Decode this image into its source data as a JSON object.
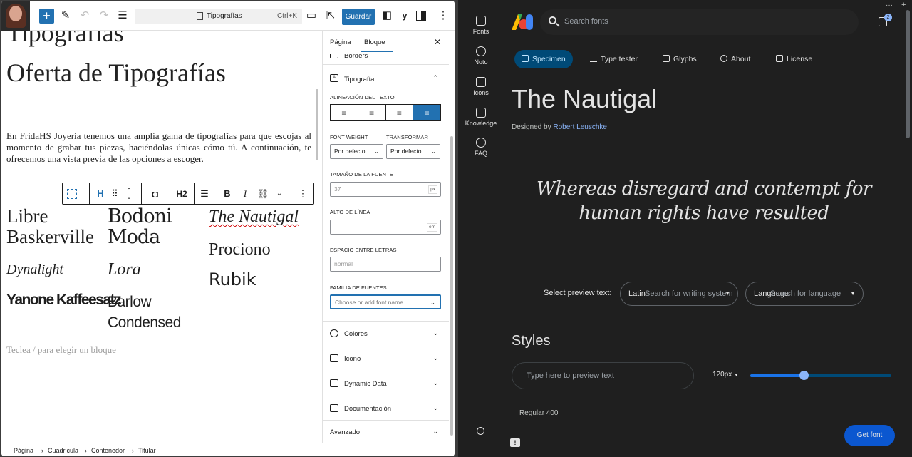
{
  "wp": {
    "toolbar": {
      "doc_title": "Tipografías",
      "shortcut": "Ctrl+K",
      "save_label": "Guardar"
    },
    "canvas": {
      "heading_cut": "Tipografías",
      "heading": "Oferta de Tipografías",
      "paragraph": "En FridaHS Joyería tenemos una amplia gama de tipografías para que escojas al momento de grabar tus piezas, haciéndolas únicas cómo tú. A continuación, te ofrecemos una vista previa de las opciones a escoger.",
      "block_toolbar": {
        "heading_level": "H2"
      },
      "fonts": [
        {
          "label": "Libre Baskerville"
        },
        {
          "label": "Bodoni Moda"
        },
        {
          "label": "The Nautigal"
        },
        {
          "label": "Prociono"
        },
        {
          "label": "Dynalight"
        },
        {
          "label": "Lora"
        },
        {
          "label": "Rubik"
        },
        {
          "label": "Yanone Kaffeesatz"
        },
        {
          "label": "Barlow Condensed"
        }
      ],
      "placeholder_hint": "Teclea / para elegir un bloque"
    },
    "sidebar": {
      "tab_page": "Página",
      "tab_block": "Bloque",
      "borders_label": "Borders",
      "typography_label": "Tipografía",
      "text_align_label": "ALINEACIÓN DEL TEXTO",
      "font_weight_label": "FONT WEIGHT",
      "font_weight_value": "Por defecto",
      "transform_label": "TRANSFORMAR",
      "transform_value": "Por defecto",
      "font_size_label": "TAMAÑO DE LA FUENTE",
      "font_size_value": "37",
      "font_size_unit": "px",
      "line_height_label": "ALTO DE LÍNEA",
      "line_height_unit": "em",
      "letter_spacing_label": "ESPACIO ENTRE LETRAS",
      "letter_spacing_placeholder": "normal",
      "font_family_label": "FAMILIA DE FUENTES",
      "font_family_placeholder": "Choose or add font name",
      "panels": [
        "Colores",
        "Icono",
        "Dynamic Data",
        "Documentación",
        "Avanzado"
      ]
    },
    "breadcrumb": [
      "Página",
      "Cuadricula",
      "Contenedor",
      "Titular"
    ]
  },
  "gf": {
    "rail": [
      {
        "label": "Fonts",
        "icon": "fonts-icon"
      },
      {
        "label": "Noto",
        "icon": "globe-icon"
      },
      {
        "label": "Icons",
        "icon": "shapes-icon"
      },
      {
        "label": "Knowledge",
        "icon": "school-icon"
      },
      {
        "label": "FAQ",
        "icon": "help-icon"
      }
    ],
    "search_placeholder": "Search fonts",
    "bag_count": "2",
    "tabs": [
      "Specimen",
      "Type tester",
      "Glyphs",
      "About",
      "License"
    ],
    "family": "The Nautigal",
    "designed_by": "Designed by",
    "designer": "Robert Leuschke",
    "specimen_text": "Whereas disregard and contempt for human rights have resulted",
    "preview_label": "Select preview text:",
    "writing_system_placeholder": "Search for writing system",
    "writing_system_value": "Latin",
    "language_placeholder": "Search for language",
    "language_value": "Language",
    "styles_heading": "Styles",
    "preview_placeholder": "Type here to preview text",
    "size_value": "120px",
    "size_slider_fraction": 0.38,
    "style_name": "Regular 400",
    "get_font": "Get font",
    "accent": "#8ab4f8"
  }
}
